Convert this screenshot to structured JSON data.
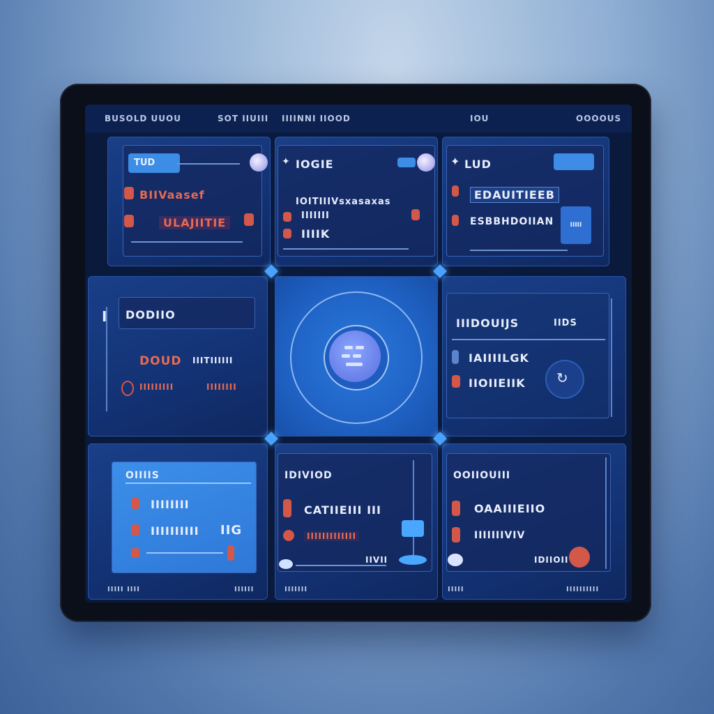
{
  "topbar": {
    "left": "BUSOLD UUOU",
    "mid1": "SOT IIUIII",
    "mid2": "IIIINNI IIOOD",
    "right1": "IOU",
    "right2": "OOOOUS"
  },
  "panels": {
    "p1": {
      "pill": "TUD",
      "row1": "BIIVaasef",
      "row2": "ULAJIITIE"
    },
    "p2": {
      "title": "IOGIE",
      "row1": "IOITIIIVsxasaxas",
      "row2": "IIIIIII",
      "row3": "IIIIK"
    },
    "p3": {
      "title": "LUD",
      "row1": "EDAUITIEEB",
      "row2": "ESBBHDOIIAN",
      "badge": "IIIII"
    },
    "p4": {
      "title": "DODIIO",
      "row1": "DOUD",
      "row1b": "IIITIIIIII",
      "row2": "IIIIIIIII",
      "row2b": "IIIIIIII"
    },
    "p5": {
      "center": "icon"
    },
    "p6": {
      "title": "IIIDOUIJS",
      "tag": "IIDS",
      "row1": "IAIIIILGK",
      "row2": "IIOIIEIIK"
    },
    "p7": {
      "title": "OIIIIS",
      "row1": "IIIIIIII",
      "row2": "IIIIIIIIII",
      "row2b": "IIG"
    },
    "p8": {
      "title": "IDIVIOD",
      "row1": "CATIIEIII III",
      "row2": "IIIIIIIIIIIII",
      "row3": "IIVII"
    },
    "p9": {
      "title": "OOIIOUIII",
      "row1": "OAAIIIEIIO",
      "row2": "IIIIIIIVIV",
      "row3": "IDIIOII"
    }
  },
  "footer": {
    "f1": "IIIII IIII",
    "f2": "IIIIII",
    "f3": "IIIIIII",
    "f4": "IIIII",
    "f5": "IIIIIIIIII"
  },
  "colors": {
    "accent": "#3d8de6",
    "alert": "#d4584a",
    "bg": "#0a1a3d"
  }
}
